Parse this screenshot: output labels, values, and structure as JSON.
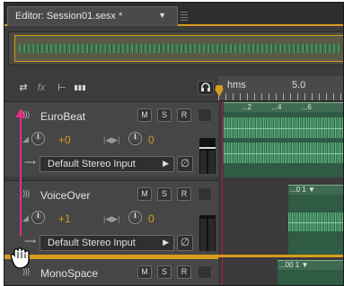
{
  "editor_tab": {
    "title": "Editor: Session01.sesx *",
    "dropdown_glyph": "▼"
  },
  "toolbar": {
    "buttons": [
      "⇄",
      "fx",
      "⊢",
      "▮▮▮"
    ],
    "headphones_icon": "headphones-icon"
  },
  "ruler": {
    "unit_label": "hms",
    "time_marker": "5.0"
  },
  "tracks": [
    {
      "name": "EuroBeat",
      "buttons": [
        "M",
        "S",
        "R"
      ],
      "volume_value": "+0",
      "pan_value": "0",
      "input": "Default Stereo Input"
    },
    {
      "name": "VoiceOver",
      "buttons": [
        "M",
        "S",
        "R"
      ],
      "volume_value": "+1",
      "pan_value": "0",
      "input": "Default Stereo Input"
    },
    {
      "name": "MonoSpace",
      "buttons": [
        "M",
        "S",
        "R"
      ]
    }
  ],
  "clips": {
    "eurobeat_labels": [
      "...2",
      "...4",
      "...6"
    ],
    "voiceover_label": "...0 1 ▼",
    "monospace_label": "...00 1 ▼"
  },
  "colors": {
    "accent": "#d89b1e",
    "drag_arrow": "#e0308a",
    "clip_wave": "#6cc28c",
    "playhead_line": "#b2223c"
  }
}
